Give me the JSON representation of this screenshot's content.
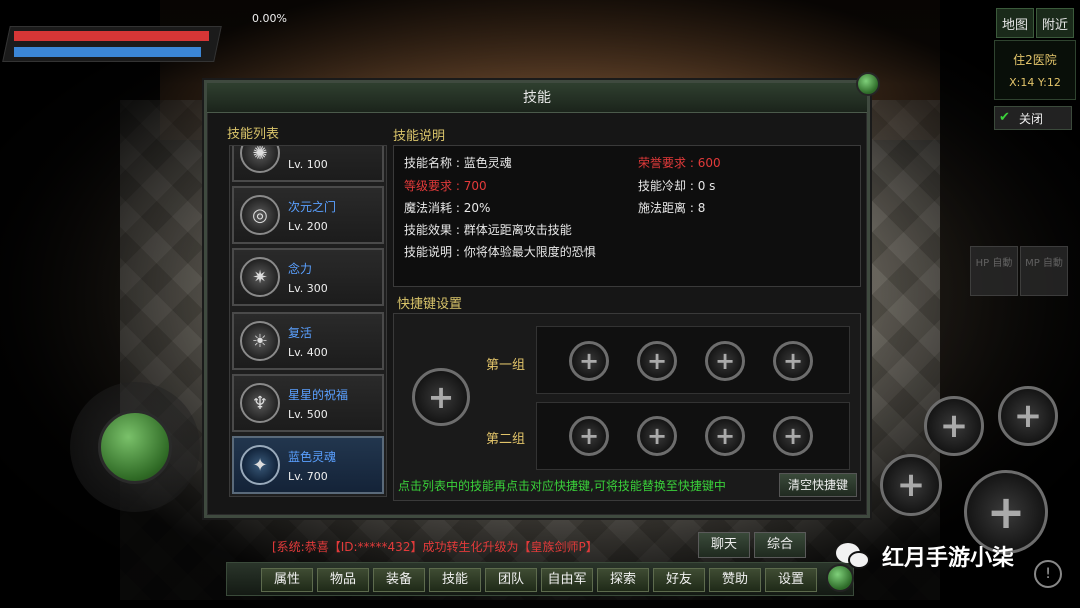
{
  "hud": {
    "exp_percent": "0.00%",
    "hp_fill": 0.93,
    "mp_fill": 0.89
  },
  "top_right": {
    "map_label": "地图",
    "nearby_label": "附近",
    "location_name": "住2医院",
    "coordinates": "X:14 Y:12",
    "close_label": "关闭"
  },
  "auto_buttons": {
    "hp_auto": "HP 自動",
    "mp_auto": "MP 自動"
  },
  "panel": {
    "title": "技能",
    "skill_list_label": "技能列表",
    "description_label": "技能说明",
    "hotkey_label": "快捷键设置"
  },
  "skills": [
    {
      "name": "",
      "level": "Lv. 100",
      "glyph": "✺",
      "selected": false
    },
    {
      "name": "次元之门",
      "level": "Lv. 200",
      "glyph": "◎",
      "selected": false
    },
    {
      "name": "念力",
      "level": "Lv. 300",
      "glyph": "✷",
      "selected": false
    },
    {
      "name": "复活",
      "level": "Lv. 400",
      "glyph": "☀",
      "selected": false
    },
    {
      "name": "星星的祝福",
      "level": "Lv. 500",
      "glyph": "♆",
      "selected": false
    },
    {
      "name": "蓝色灵魂",
      "level": "Lv. 700",
      "glyph": "✦",
      "selected": true
    }
  ],
  "description": {
    "name_label": "技能名称",
    "name_value": "蓝色灵魂",
    "honor_label": "荣誉要求",
    "honor_value": "600",
    "level_req_label": "等级要求",
    "level_req_value": "700",
    "cooldown_label": "技能冷却",
    "cooldown_value": "0 s",
    "mana_label": "魔法消耗",
    "mana_value": "20%",
    "range_label": "施法距离",
    "range_value": "8",
    "effect_label": "技能效果",
    "effect_value": "群体远距离攻击技能",
    "explain_label": "技能说明",
    "explain_value": "你将体验最大限度的恐惧"
  },
  "hotkeys": {
    "group1": "第一组",
    "group2": "第二组",
    "note": "点击列表中的技能再点击对应快捷键,可将技能替换至快捷键中",
    "clear_label": "清空快捷键"
  },
  "system_message": "[系统:恭喜【ID:*****432】成功转生化升级为【皇族剑师P】",
  "chat": {
    "chat_label": "聊天",
    "general_label": "综合"
  },
  "menu": [
    "属性",
    "物品",
    "装备",
    "技能",
    "团队",
    "自由军",
    "探索",
    "好友",
    "赞助",
    "设置"
  ],
  "watermark": "红月手游小柒",
  "colors": {
    "hp": "#d63636",
    "mp": "#3b86d6",
    "skill_name": "#5aa0ff",
    "requirement_red": "#e23a3a",
    "hint_green": "#3ad13a",
    "gold_label": "#d9c46a"
  }
}
